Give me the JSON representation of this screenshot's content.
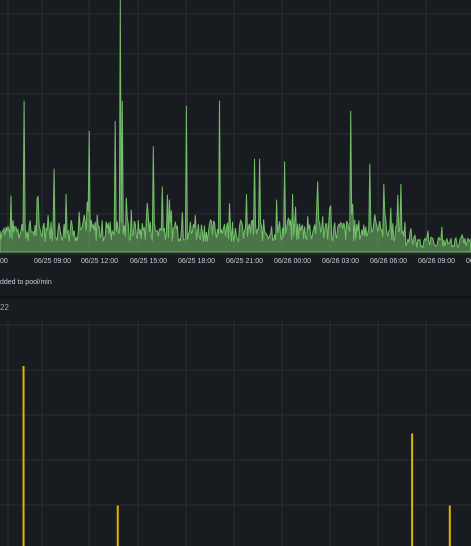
{
  "top_panel": {
    "legend_text": "dded to pool/min"
  },
  "bottom_panel": {
    "title_text": "22"
  },
  "colors": {
    "background": "#181b1f",
    "grid": "#2a2d33",
    "series_top": "#73bf69",
    "series_bottom": "#e0b400"
  },
  "chart_data": [
    {
      "type": "area",
      "x_tick_labels": [
        "00",
        "06/25 09:00",
        "06/25 12:00",
        "06/25 15:00",
        "06/25 18:00",
        "06/25 21:00",
        "06/26 00:00",
        "06/26 03:00",
        "06/26 06:00",
        "06/26 09:00",
        "06/26 1"
      ],
      "series": [
        {
          "baseline_level": 0.1,
          "spikes": [
            {
              "at": 0.05,
              "value": 0.6
            },
            {
              "at": 0.115,
              "value": 0.33
            },
            {
              "at": 0.14,
              "value": 0.23
            },
            {
              "at": 0.19,
              "value": 0.48
            },
            {
              "at": 0.245,
              "value": 0.52
            },
            {
              "at": 0.255,
              "value": 1.0
            },
            {
              "at": 0.26,
              "value": 0.6
            },
            {
              "at": 0.325,
              "value": 0.42
            },
            {
              "at": 0.345,
              "value": 0.26
            },
            {
              "at": 0.395,
              "value": 0.58
            },
            {
              "at": 0.465,
              "value": 0.6
            },
            {
              "at": 0.54,
              "value": 0.37
            },
            {
              "at": 0.55,
              "value": 0.37
            },
            {
              "at": 0.605,
              "value": 0.36
            },
            {
              "at": 0.675,
              "value": 0.28
            },
            {
              "at": 0.745,
              "value": 0.56
            },
            {
              "at": 0.785,
              "value": 0.35
            },
            {
              "at": 0.815,
              "value": 0.27
            },
            {
              "at": 0.85,
              "value": 0.27
            }
          ]
        }
      ]
    },
    {
      "type": "bar",
      "series": [
        {
          "spikes": [
            {
              "at": 0.05,
              "value": 0.8
            },
            {
              "at": 0.25,
              "value": 0.18
            },
            {
              "at": 0.875,
              "value": 0.5
            },
            {
              "at": 0.955,
              "value": 0.18
            }
          ]
        }
      ]
    }
  ]
}
